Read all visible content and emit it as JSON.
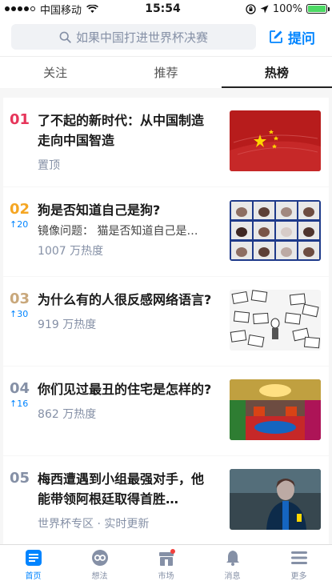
{
  "status": {
    "carrier": "中国移动",
    "time": "15:54",
    "battery": "100%",
    "battery_level": 1.0
  },
  "search": {
    "placeholder": "如果中国打进世界杯决赛"
  },
  "ask_label": "提问",
  "tabs": [
    {
      "label": "关注"
    },
    {
      "label": "推荐"
    },
    {
      "label": "热榜"
    }
  ],
  "feed": [
    {
      "rank": "01",
      "trend": "",
      "title": "了不起的新时代：从中国制造走向中国智造",
      "excerpt": "",
      "meta": "置顶",
      "rank_color": "#e6355a"
    },
    {
      "rank": "02",
      "trend": "↑20",
      "title": "狗是否知道自己是狗?",
      "excerpt": "镜像问题： 猫是否知道自己是…",
      "meta": "1007 万热度",
      "rank_color": "#f5a623"
    },
    {
      "rank": "03",
      "trend": "↑30",
      "title": "为什么有的人很反感网络语言?",
      "excerpt": "",
      "meta": "919 万热度",
      "rank_color": "#c9a87c"
    },
    {
      "rank": "04",
      "trend": "↑16",
      "title": "你们见过最丑的住宅是怎样的?",
      "excerpt": "",
      "meta": "862 万热度",
      "rank_color": "#8590a6"
    },
    {
      "rank": "05",
      "trend": "",
      "title": "梅西遭遇到小组最强对手，他能带领阿根廷取得首胜…",
      "excerpt": "",
      "meta": "世界杯专区 · 实时更新",
      "rank_color": "#8590a6"
    }
  ],
  "tabbar": [
    {
      "label": "首页"
    },
    {
      "label": "想法"
    },
    {
      "label": "市场"
    },
    {
      "label": "消息"
    },
    {
      "label": "更多"
    }
  ],
  "colors": {
    "accent": "#0084ff"
  }
}
